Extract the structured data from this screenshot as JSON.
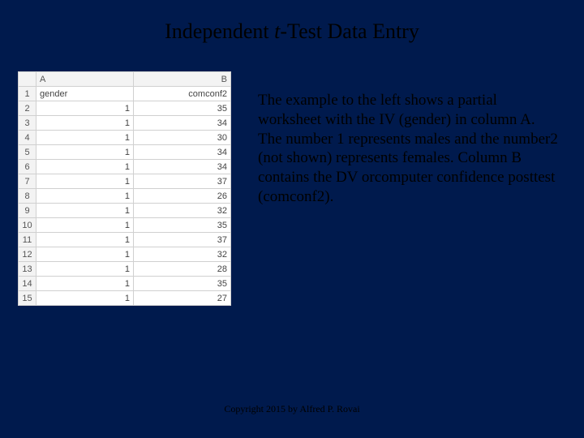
{
  "title_pre": "Independent ",
  "title_t": "t",
  "title_post": "-Test Data Entry",
  "spreadsheet": {
    "col_labels": [
      "A",
      "B"
    ],
    "header_row": {
      "a": "gender",
      "b": "comconf2"
    },
    "rows": [
      {
        "n": "1"
      },
      {
        "n": "2",
        "a": "1",
        "b": "35"
      },
      {
        "n": "3",
        "a": "1",
        "b": "34"
      },
      {
        "n": "4",
        "a": "1",
        "b": "30"
      },
      {
        "n": "5",
        "a": "1",
        "b": "34"
      },
      {
        "n": "6",
        "a": "1",
        "b": "34"
      },
      {
        "n": "7",
        "a": "1",
        "b": "37"
      },
      {
        "n": "8",
        "a": "1",
        "b": "26"
      },
      {
        "n": "9",
        "a": "1",
        "b": "32"
      },
      {
        "n": "10",
        "a": "1",
        "b": "35"
      },
      {
        "n": "11",
        "a": "1",
        "b": "37"
      },
      {
        "n": "12",
        "a": "1",
        "b": "32"
      },
      {
        "n": "13",
        "a": "1",
        "b": "28"
      },
      {
        "n": "14",
        "a": "1",
        "b": "35"
      },
      {
        "n": "15",
        "a": "1",
        "b": "27"
      }
    ]
  },
  "body": "The example to the left shows a partial worksheet with the IV (gender) in column A. The number 1 represents males and the number2 (not shown) represents females. Column B contains the DV orcomputer confidence posttest (comconf2).",
  "footer": "Copyright 2015 by Alfred P. Rovai"
}
